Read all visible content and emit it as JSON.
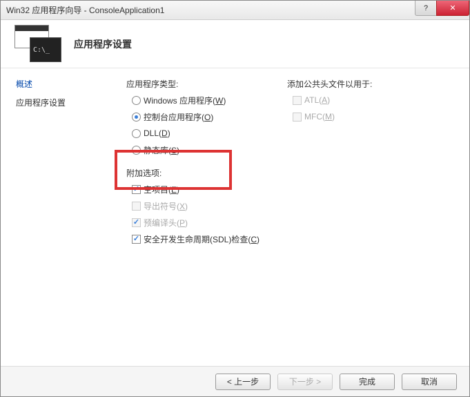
{
  "titlebar": {
    "title": "Win32 应用程序向导 - ConsoleApplication1",
    "help": "?",
    "close": "✕"
  },
  "banner": {
    "title": "应用程序设置",
    "console_prompt": "C:\\_"
  },
  "nav": {
    "overview": "概述",
    "settings": "应用程序设置"
  },
  "form": {
    "app_type_label": "应用程序类型:",
    "app_type": {
      "windows": {
        "label": "Windows 应用程序(",
        "key": "W",
        "suffix": ")"
      },
      "console": {
        "label": "控制台应用程序(",
        "key": "O",
        "suffix": ")"
      },
      "dll": {
        "label": "DLL(",
        "key": "D",
        "suffix": ")"
      },
      "static": {
        "label": "静态库(",
        "key": "S",
        "suffix": ")"
      }
    },
    "additional_label": "附加选项:",
    "additional": {
      "empty": {
        "label": "空项目(",
        "key": "E",
        "suffix": ")"
      },
      "export": {
        "label": "导出符号(",
        "key": "X",
        "suffix": ")"
      },
      "pch": {
        "label": "预编译头(",
        "key": "P",
        "suffix": ")"
      },
      "sdl": {
        "label": "安全开发生命周期(SDL)检查(",
        "key": "C",
        "suffix": ")"
      }
    },
    "headers_label": "添加公共头文件以用于:",
    "headers": {
      "atl": {
        "label": "ATL(",
        "key": "A",
        "suffix": ")"
      },
      "mfc": {
        "label": "MFC(",
        "key": "M",
        "suffix": ")"
      }
    }
  },
  "footer": {
    "prev": "< 上一步",
    "next": "下一步 >",
    "finish": "完成",
    "cancel": "取消"
  },
  "watermark": ""
}
